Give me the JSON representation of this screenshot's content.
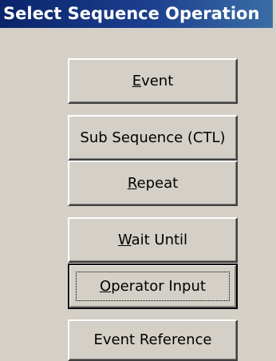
{
  "window": {
    "title": "Select Sequence Operation"
  },
  "buttons": [
    {
      "mnemonic": "E",
      "rest": "vent"
    },
    {
      "mnemonic": "",
      "rest": "Sub Sequence (CTL)"
    },
    {
      "mnemonic": "R",
      "rest": "epeat"
    },
    {
      "mnemonic": "W",
      "rest": "ait Until"
    },
    {
      "mnemonic": "O",
      "rest": "perator Input",
      "focused": true
    },
    {
      "mnemonic": "",
      "rest": "Event Reference"
    }
  ]
}
